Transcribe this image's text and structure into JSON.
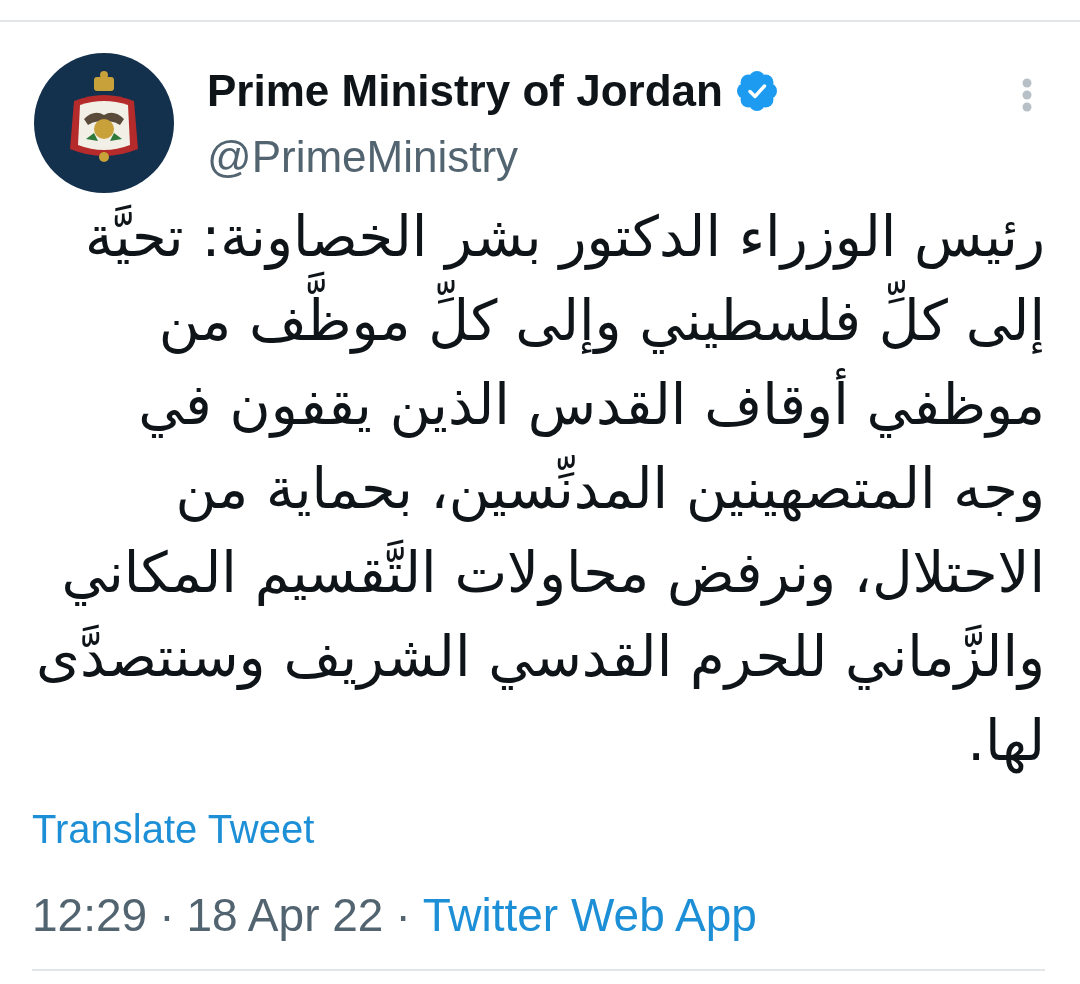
{
  "tweet": {
    "author": {
      "name": "Prime Ministry of Jordan",
      "verified": true,
      "handle": "@PrimeMinistry"
    },
    "text": "رئيس الوزراء الدكتور بشر الخصاونة: تحيَّة إلى كلِّ فلسطيني وإلى كلِّ موظَّف من موظفي أوقاف القدس الذين يقفون في وجه المتصهينين المدنِّسين، بحماية من الاحتلال، ونرفض محاولات التَّقسيم المكاني والزَّماني للحرم القدسي الشريف وسنتصدَّى لها.",
    "translate_link": "Translate Tweet",
    "meta": {
      "time": "12:29",
      "separator_1": "·",
      "date": "18 Apr 22",
      "separator_2": "·",
      "source": "Twitter Web App"
    }
  }
}
